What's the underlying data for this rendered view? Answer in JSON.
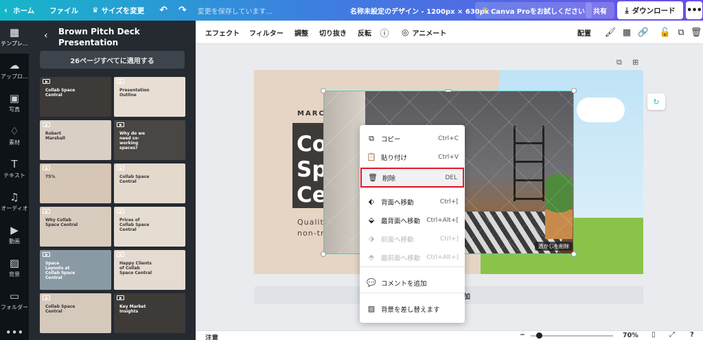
{
  "topbar": {
    "home": "ホーム",
    "file": "ファイル",
    "resize": "サイズを変更",
    "saving_status": "変更を保存しています...",
    "doc_title": "名称未設定のデザイン - 1200px × 630px",
    "canva_pro": "Canva Proをお試しください",
    "share": "共有",
    "download": "ダウンロード",
    "more": "•••",
    "crown_icon": "♛"
  },
  "rail": {
    "items": [
      {
        "label": "テンプレ…",
        "icon": "▦"
      },
      {
        "label": "アップロ…",
        "icon": "☁"
      },
      {
        "label": "写真",
        "icon": "▣"
      },
      {
        "label": "素材",
        "icon": "♢"
      },
      {
        "label": "テキスト",
        "icon": "T"
      },
      {
        "label": "オーディオ",
        "icon": "♫"
      },
      {
        "label": "動画",
        "icon": "▶"
      },
      {
        "label": "背景",
        "icon": "▨"
      },
      {
        "label": "フォルダー",
        "icon": "▭"
      },
      {
        "label": "",
        "icon": "•••"
      }
    ]
  },
  "panel": {
    "title": "Brown Pitch Deck Presentation",
    "apply_all": "26ページすべてに適用する",
    "thumbs": [
      {
        "label": "Collab Space Central",
        "bg": "#3d3a37",
        "light": true
      },
      {
        "label": "Presentation Outline",
        "bg": "#e8ded3",
        "light": false
      },
      {
        "label": "Robert Marshall",
        "bg": "#d9cfc4",
        "light": false
      },
      {
        "label": "Why do we need co-working spaces?",
        "bg": "#4a4643",
        "light": true
      },
      {
        "label": "75%",
        "bg": "#d6c6b6",
        "light": false
      },
      {
        "label": "Collab Space Central",
        "bg": "#e3d9cd",
        "light": false
      },
      {
        "label": "Why Collab Space Central",
        "bg": "#d8ccbf",
        "light": false
      },
      {
        "label": "Prices of Collab Space Central",
        "bg": "#e6ddd2",
        "light": false
      },
      {
        "label": "Space Layouts at Collab Space Central",
        "bg": "#8a9aa5",
        "light": true
      },
      {
        "label": "Happy Clients of Collab Space Central",
        "bg": "#e5dbd0",
        "light": false
      },
      {
        "label": "Collab Space Central",
        "bg": "#d5c9bc",
        "light": false
      },
      {
        "label": "Key Market Insights",
        "bg": "#3d3a37",
        "light": true
      }
    ]
  },
  "toolbar": {
    "effect": "エフェクト",
    "filter": "フィルター",
    "adjust": "調整",
    "crop": "切り抜き",
    "flip": "反転",
    "info_icon": "ⓘ",
    "animate": "アニメート",
    "position": "配置"
  },
  "slide": {
    "march": "MARCH",
    "big_text": "Co\nSp\nCe",
    "quality": "Quality\nnon-tra",
    "remove_watermark": "透かしを削除",
    "add_page": "加"
  },
  "context_menu": {
    "items": [
      {
        "label": "コピー",
        "shortcut": "Ctrl+C",
        "icon": "⧉",
        "disabled": false,
        "highlight": false
      },
      {
        "label": "貼り付け",
        "shortcut": "Ctrl+V",
        "icon": "📋",
        "disabled": false,
        "highlight": false
      },
      {
        "label": "削除",
        "shortcut": "DEL",
        "icon": "🗑",
        "disabled": false,
        "highlight": true
      },
      {
        "label": "背面へ移動",
        "shortcut": "Ctrl+[",
        "icon": "⬖",
        "disabled": false,
        "highlight": false
      },
      {
        "label": "最背面へ移動",
        "shortcut": "Ctrl+Alt+[",
        "icon": "⬙",
        "disabled": false,
        "highlight": false
      },
      {
        "label": "前面へ移動",
        "shortcut": "Ctrl+]",
        "icon": "⬗",
        "disabled": true,
        "highlight": false
      },
      {
        "label": "最前面へ移動",
        "shortcut": "Ctrl+Alt+]",
        "icon": "⬘",
        "disabled": true,
        "highlight": false
      },
      {
        "label": "コメントを追加",
        "shortcut": "",
        "icon": "💬",
        "disabled": false,
        "highlight": false
      },
      {
        "label": "背景を差し替えます",
        "shortcut": "",
        "icon": "▨",
        "disabled": false,
        "highlight": false
      }
    ]
  },
  "bottombar": {
    "note": "注意",
    "zoom": "70%",
    "help": "?"
  },
  "colors": {
    "accent_teal": "#3fd0c6",
    "highlight_red": "#e0192a",
    "panel_bg": "#252a31",
    "rail_bg": "#0e1318"
  }
}
